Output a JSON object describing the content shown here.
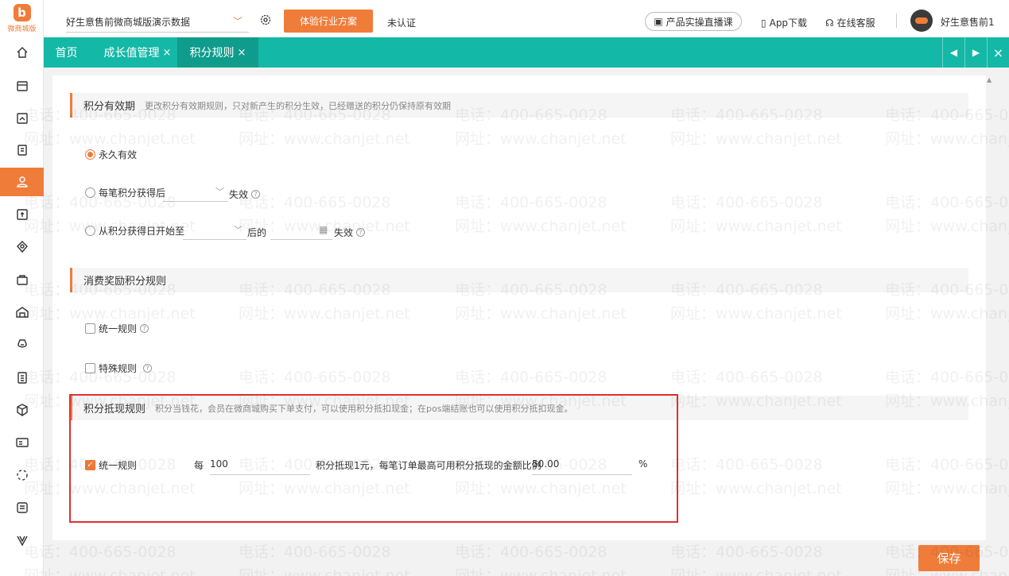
{
  "brand": {
    "logo_text": "微商城版",
    "accent": "#f07c3a",
    "teal": "#14b8a6"
  },
  "topbar": {
    "store_name": "好生意售前微商城版演示数据",
    "industry_button": "体验行业方案",
    "auth_status": "未认证",
    "live_course": "产品实操直播课",
    "app_download": "App下载",
    "online_service": "在线客服",
    "user_name": "好生意售前1"
  },
  "sidebar": {
    "icons": [
      "home-icon",
      "store-icon",
      "order-icon",
      "report-icon",
      "member-icon",
      "finance-icon",
      "marketing-icon",
      "bag-icon",
      "warehouse-icon",
      "money-icon",
      "clipboard-icon",
      "cube-icon",
      "card-icon",
      "loading-icon",
      "news-icon",
      "vip-icon"
    ],
    "active_index": 4
  },
  "tabs": [
    {
      "label": "首页",
      "closable": false
    },
    {
      "label": "成长值管理",
      "closable": true
    },
    {
      "label": "积分规则",
      "closable": true,
      "active": true
    }
  ],
  "validity": {
    "title": "积分有效期",
    "desc": "更改积分有效期规则，只对新产生的积分生效，已经赠送的积分仍保持原有效期",
    "opt_forever": "永久有效",
    "opt_each_after": "每笔积分获得后",
    "opt_each_suffix": "失效",
    "opt_from_date": "从积分获得日开始至",
    "opt_from_mid": "后的",
    "opt_from_suffix": "失效"
  },
  "consume": {
    "title": "消费奖励积分规则",
    "opt_unified": "统一规则",
    "opt_special": "特殊规则"
  },
  "cash": {
    "title": "积分抵现规则",
    "desc": "积分当钱花，会员在微商城购买下单支付，可以使用积分抵扣现金；在pos端结账也可以使用积分抵扣现金。",
    "opt_unified": "统一规则",
    "per_label": "每",
    "points_value": "100",
    "mid_text": "积分抵现1元，每笔订单最高可用积分抵现的金额比例",
    "ratio_value": "50.00",
    "percent": "%"
  },
  "save_label": "保存",
  "watermark": {
    "phone": "电话：400-665-0028",
    "site": "网址：www.chanjet.net"
  }
}
